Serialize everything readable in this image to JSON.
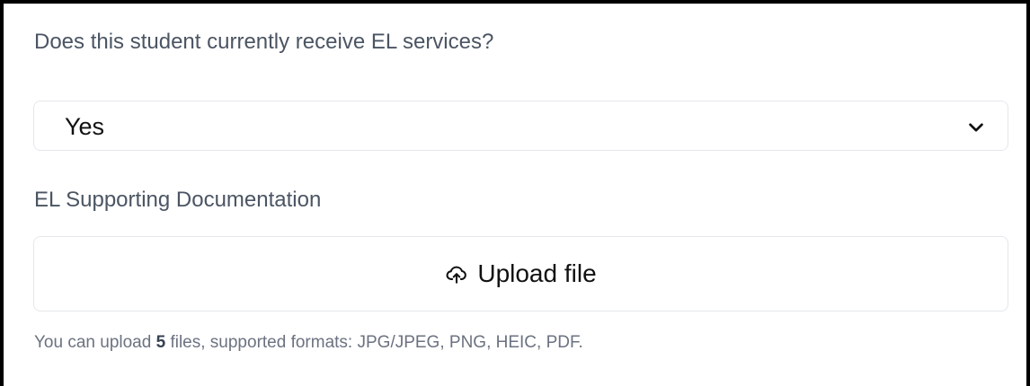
{
  "question": {
    "label": "Does this student currently receive EL services?",
    "selected_value": "Yes",
    "icon": "chevron-down-icon"
  },
  "documentation": {
    "label": "EL Supporting Documentation",
    "upload_button_label": "Upload file",
    "upload_icon": "cloud-upload-icon",
    "hint_prefix": "You can upload ",
    "hint_count": "5",
    "hint_suffix": " files, supported formats: JPG/JPEG, PNG, HEIC, PDF."
  },
  "colors": {
    "label_text": "#4b5563",
    "value_text": "#111111",
    "hint_text": "#6b7280",
    "border": "#e5e7eb",
    "frame": "#000000"
  }
}
